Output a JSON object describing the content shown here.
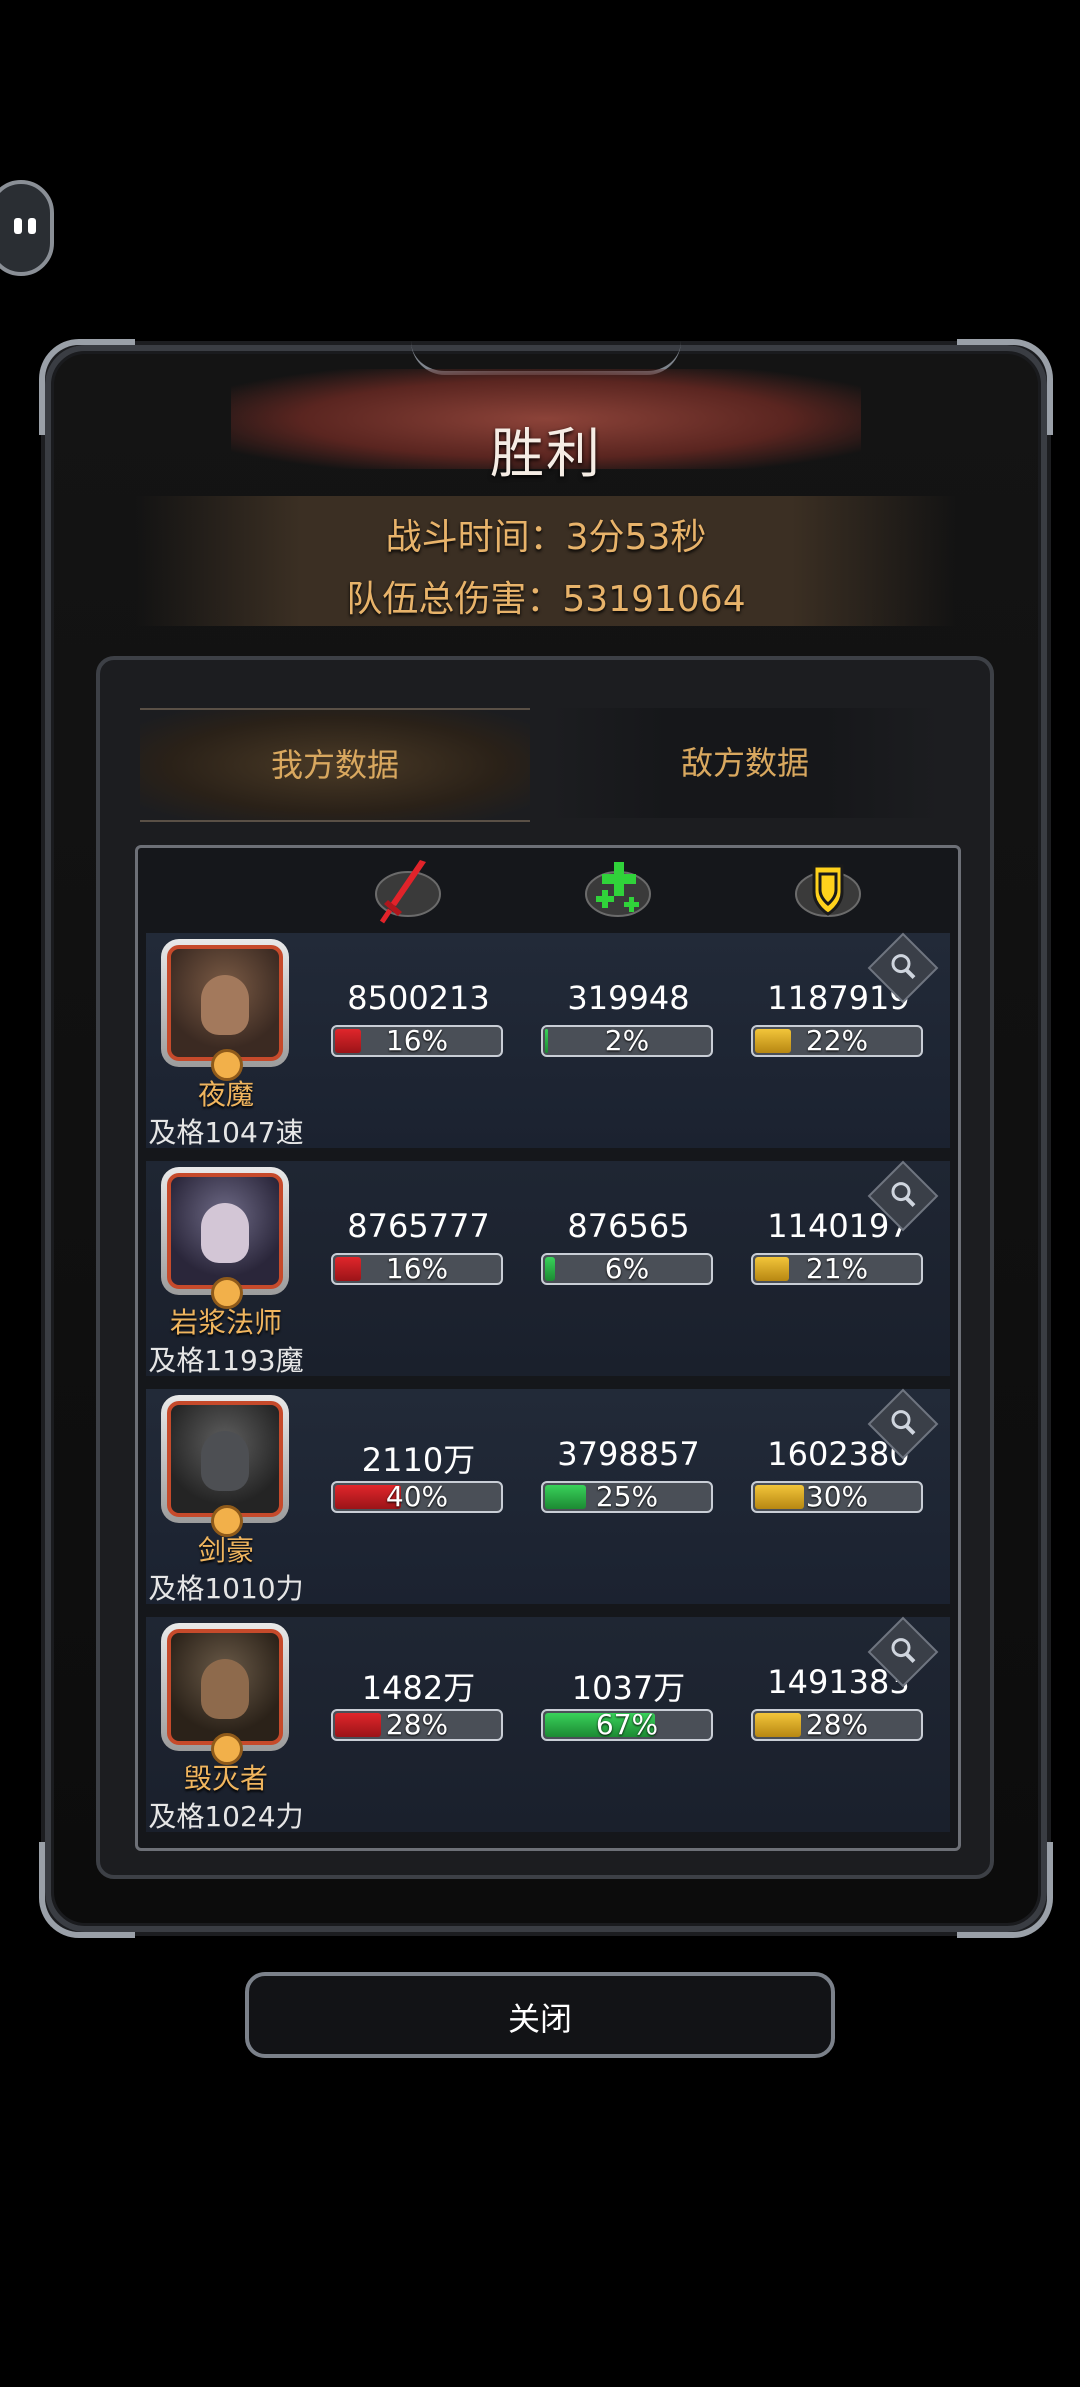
{
  "title": "胜利",
  "battle": {
    "time_line": "战斗时间：3分53秒",
    "damage_line": "队伍总伤害：53191064"
  },
  "tabs": [
    {
      "label": "我方数据",
      "active": true
    },
    {
      "label": "敌方数据",
      "active": false
    }
  ],
  "columns": [
    {
      "icon": "sword-icon",
      "meaning": "damage"
    },
    {
      "icon": "heal-cross-icon",
      "meaning": "healing"
    },
    {
      "icon": "shield-icon",
      "meaning": "damage-taken"
    }
  ],
  "heroes": [
    {
      "name": "夜魔",
      "sub": "及格1047速",
      "damage": "8500213",
      "damage_pct": "16%",
      "damage_frac": 0.16,
      "heal": "319948",
      "heal_pct": "2%",
      "heal_frac": 0.02,
      "tank": "1187919",
      "tank_pct": "22%",
      "tank_frac": 0.22
    },
    {
      "name": "岩浆法师",
      "sub": "及格1193魔",
      "damage": "8765777",
      "damage_pct": "16%",
      "damage_frac": 0.16,
      "heal": "876565",
      "heal_pct": "6%",
      "heal_frac": 0.06,
      "tank": "1140197",
      "tank_pct": "21%",
      "tank_frac": 0.21
    },
    {
      "name": "剑豪",
      "sub": "及格1010力",
      "damage": "2110万",
      "damage_pct": "40%",
      "damage_frac": 0.4,
      "heal": "3798857",
      "heal_pct": "25%",
      "heal_frac": 0.25,
      "tank": "1602380",
      "tank_pct": "30%",
      "tank_frac": 0.3
    },
    {
      "name": "毁灭者",
      "sub": "及格1024力",
      "damage": "1482万",
      "damage_pct": "28%",
      "damage_frac": 0.28,
      "heal": "1037万",
      "heal_pct": "67%",
      "heal_frac": 0.67,
      "tank": "1491383",
      "tank_pct": "28%",
      "tank_frac": 0.28
    }
  ],
  "close_label": "关闭"
}
